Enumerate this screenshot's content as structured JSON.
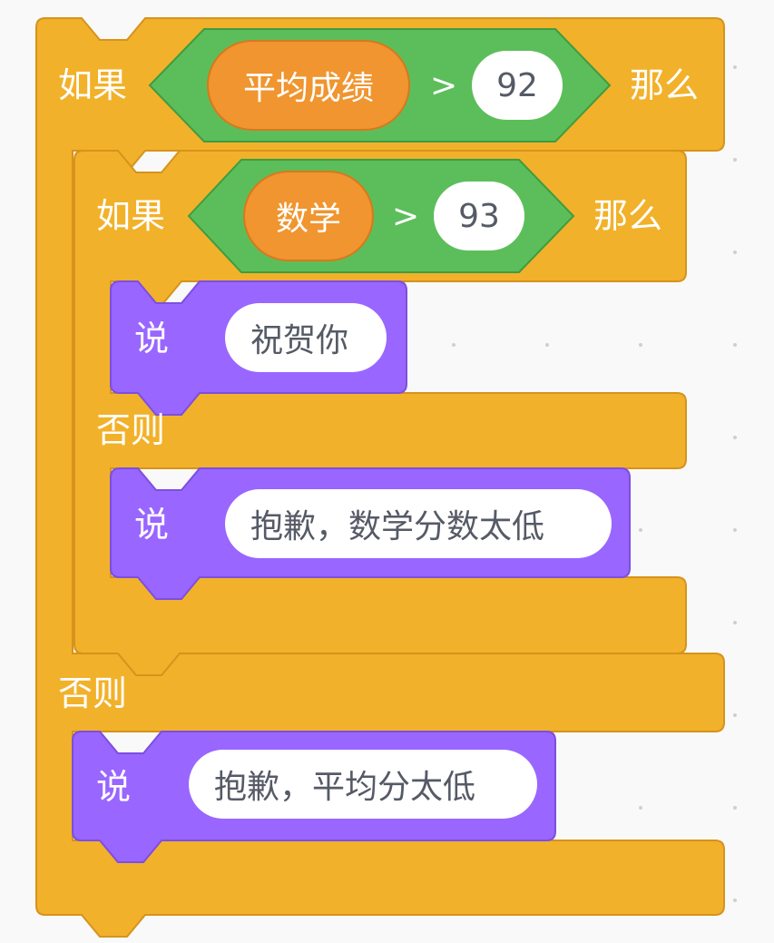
{
  "blocks": {
    "outer_if": {
      "if_label": "如果",
      "condition": {
        "operator": ">",
        "left_variable": "平均成绩",
        "right_value": "92"
      },
      "then_label": "那么",
      "else_label": "否则"
    },
    "inner_if": {
      "if_label": "如果",
      "condition": {
        "operator": ">",
        "left_variable": "数学",
        "right_value": "93"
      },
      "then_label": "那么",
      "else_label": "否则"
    },
    "say_1": {
      "label": "说",
      "message": "祝贺你"
    },
    "say_2": {
      "label": "说",
      "message": "抱歉，数学分数太低"
    },
    "say_3": {
      "label": "说",
      "message": "抱歉，平均分太低"
    }
  },
  "colors": {
    "control": "#f2b12a",
    "control_border": "#d6931d",
    "operator": "#5cbe5b",
    "operator_border": "#3f9c40",
    "variable": "#f0952f",
    "looks": "#9966ff",
    "looks_border": "#7c4fe0"
  }
}
